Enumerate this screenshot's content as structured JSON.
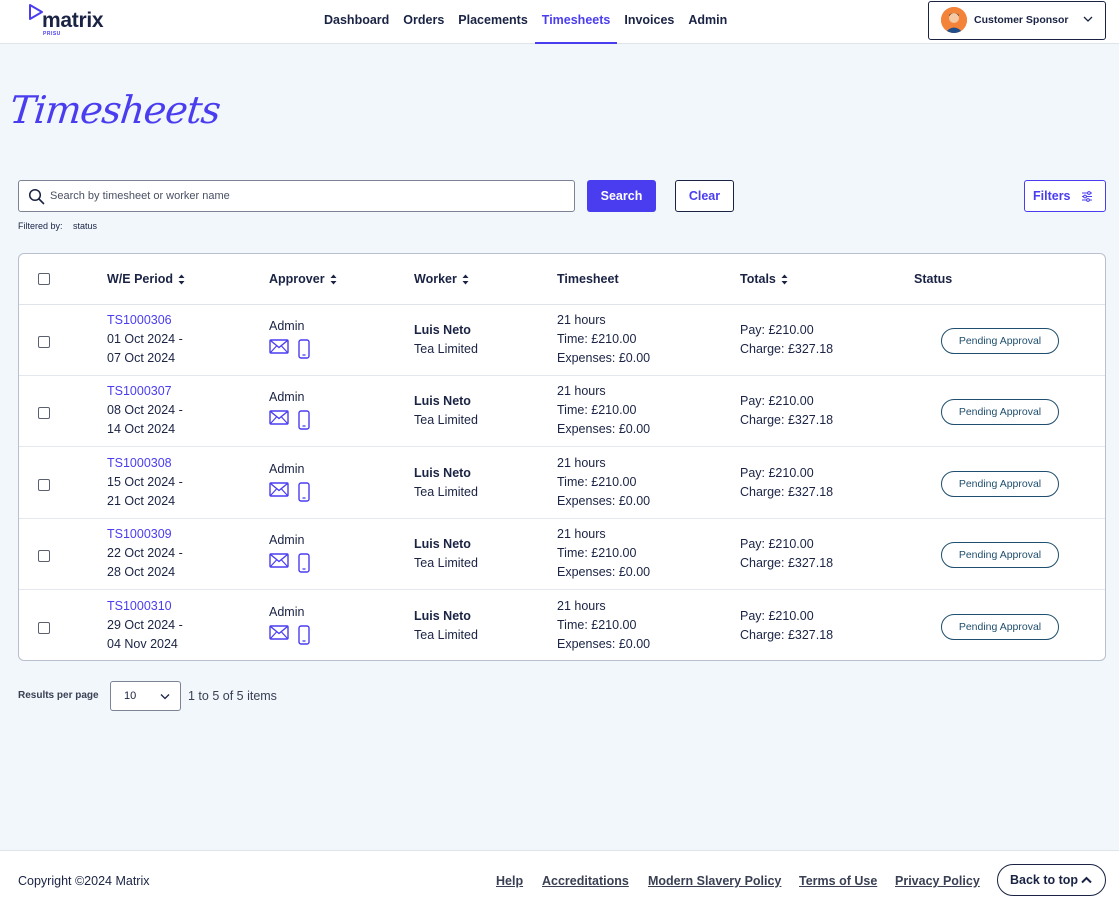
{
  "app": {
    "logo_text": "matrix",
    "logo_sub": "PRISU",
    "brand_color": "#4a3df0"
  },
  "nav": {
    "items": [
      {
        "label": "Dashboard"
      },
      {
        "label": "Orders"
      },
      {
        "label": "Placements"
      },
      {
        "label": "Timesheets",
        "active": true
      },
      {
        "label": "Invoices"
      },
      {
        "label": "Admin"
      }
    ]
  },
  "user": {
    "name": "Customer Sponsor",
    "avatar_icon": "user-avatar"
  },
  "page": {
    "title": "Timesheets"
  },
  "search": {
    "placeholder": "Search by timesheet or worker name",
    "value": "",
    "search_label": "Search",
    "clear_label": "Clear",
    "filters_label": "Filters",
    "filtered_by_label": "Filtered by:",
    "filtered_by_value": "status"
  },
  "table": {
    "columns": [
      {
        "label": "W/E Period",
        "sortable": true
      },
      {
        "label": "Approver",
        "sortable": true
      },
      {
        "label": "Worker",
        "sortable": true
      },
      {
        "label": "Timesheet",
        "sortable": false
      },
      {
        "label": "Totals",
        "sortable": true
      },
      {
        "label": "Status",
        "sortable": false
      }
    ],
    "rows": [
      {
        "id": "TS1000306",
        "period_start": "01 Oct 2024 -",
        "period_end": "07 Oct 2024",
        "approver": "Admin",
        "worker": "Luis Neto",
        "company": "Tea Limited",
        "hours": "21 hours",
        "time": "Time: £210.00",
        "expenses": "Expenses: £0.00",
        "pay": "Pay: £210.00",
        "charge": "Charge: £327.18",
        "status": "Pending Approval"
      },
      {
        "id": "TS1000307",
        "period_start": "08 Oct 2024 -",
        "period_end": "14 Oct 2024",
        "approver": "Admin",
        "worker": "Luis Neto",
        "company": "Tea Limited",
        "hours": "21 hours",
        "time": "Time: £210.00",
        "expenses": "Expenses: £0.00",
        "pay": "Pay: £210.00",
        "charge": "Charge: £327.18",
        "status": "Pending Approval"
      },
      {
        "id": "TS1000308",
        "period_start": "15 Oct 2024 -",
        "period_end": "21 Oct 2024",
        "approver": "Admin",
        "worker": "Luis Neto",
        "company": "Tea Limited",
        "hours": "21 hours",
        "time": "Time: £210.00",
        "expenses": "Expenses: £0.00",
        "pay": "Pay: £210.00",
        "charge": "Charge: £327.18",
        "status": "Pending Approval"
      },
      {
        "id": "TS1000309",
        "period_start": "22 Oct 2024 -",
        "period_end": "28 Oct 2024",
        "approver": "Admin",
        "worker": "Luis Neto",
        "company": "Tea Limited",
        "hours": "21 hours",
        "time": "Time: £210.00",
        "expenses": "Expenses: £0.00",
        "pay": "Pay: £210.00",
        "charge": "Charge: £327.18",
        "status": "Pending Approval"
      },
      {
        "id": "TS1000310",
        "period_start": "29 Oct 2024 -",
        "period_end": "04 Nov 2024",
        "approver": "Admin",
        "worker": "Luis Neto",
        "company": "Tea Limited",
        "hours": "21 hours",
        "time": "Time: £210.00",
        "expenses": "Expenses: £0.00",
        "pay": "Pay: £210.00",
        "charge": "Charge: £327.18",
        "status": "Pending Approval"
      }
    ]
  },
  "pagination": {
    "results_per_page_label": "Results per page",
    "results_per_page": "10",
    "summary": "1 to 5 of 5 items"
  },
  "footer": {
    "copyright": "Copyright ©2024 Matrix",
    "links": [
      {
        "label": "Help"
      },
      {
        "label": "Accreditations"
      },
      {
        "label": "Modern Slavery Policy"
      },
      {
        "label": "Terms of Use"
      },
      {
        "label": "Privacy Policy"
      }
    ],
    "back_to_top": "Back to top"
  }
}
